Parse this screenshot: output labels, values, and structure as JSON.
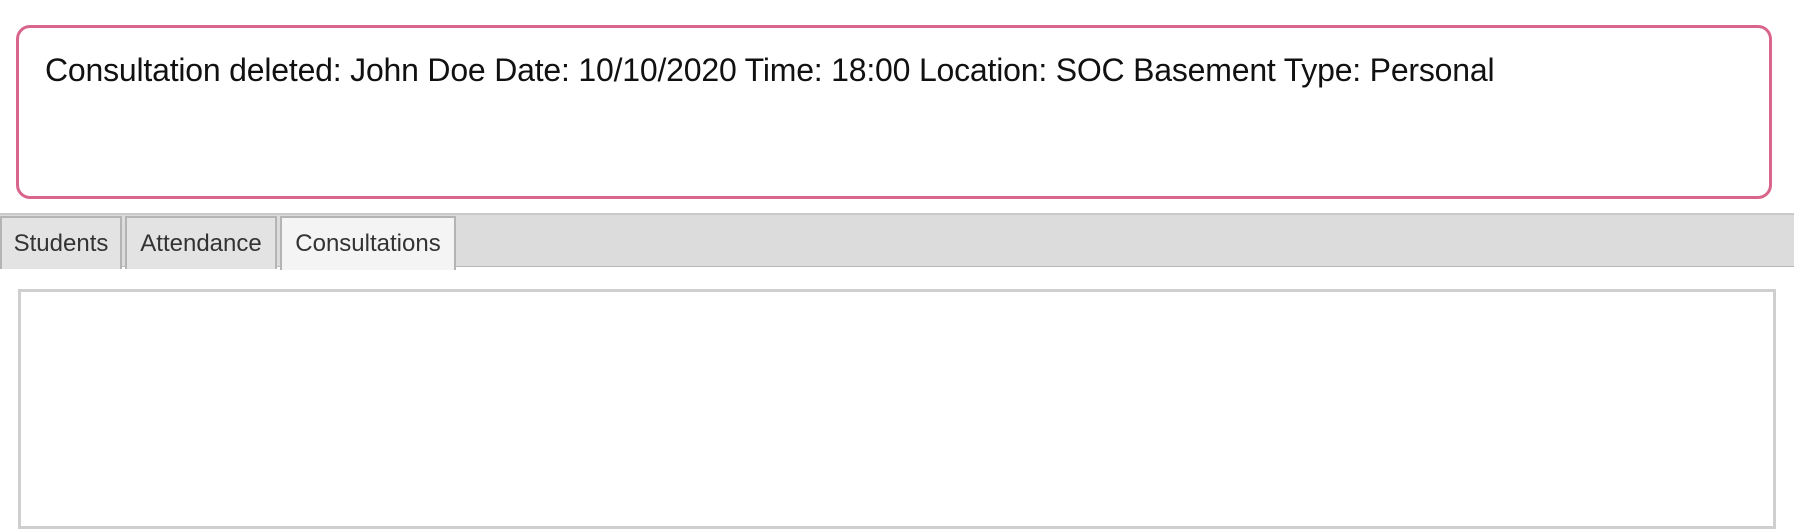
{
  "result_display": {
    "text": "Consultation deleted: John Doe Date: 10/10/2020 Time: 18:00 Location: SOC Basement Type: Personal"
  },
  "tabs": [
    {
      "label": "Students",
      "selected": false
    },
    {
      "label": "Attendance",
      "selected": false
    },
    {
      "label": "Consultations",
      "selected": true
    }
  ],
  "colors": {
    "result_border": "#d9658a",
    "tab_bar_bg": "#dcdcdc",
    "selected_tab_bg": "#f4f4f4"
  }
}
